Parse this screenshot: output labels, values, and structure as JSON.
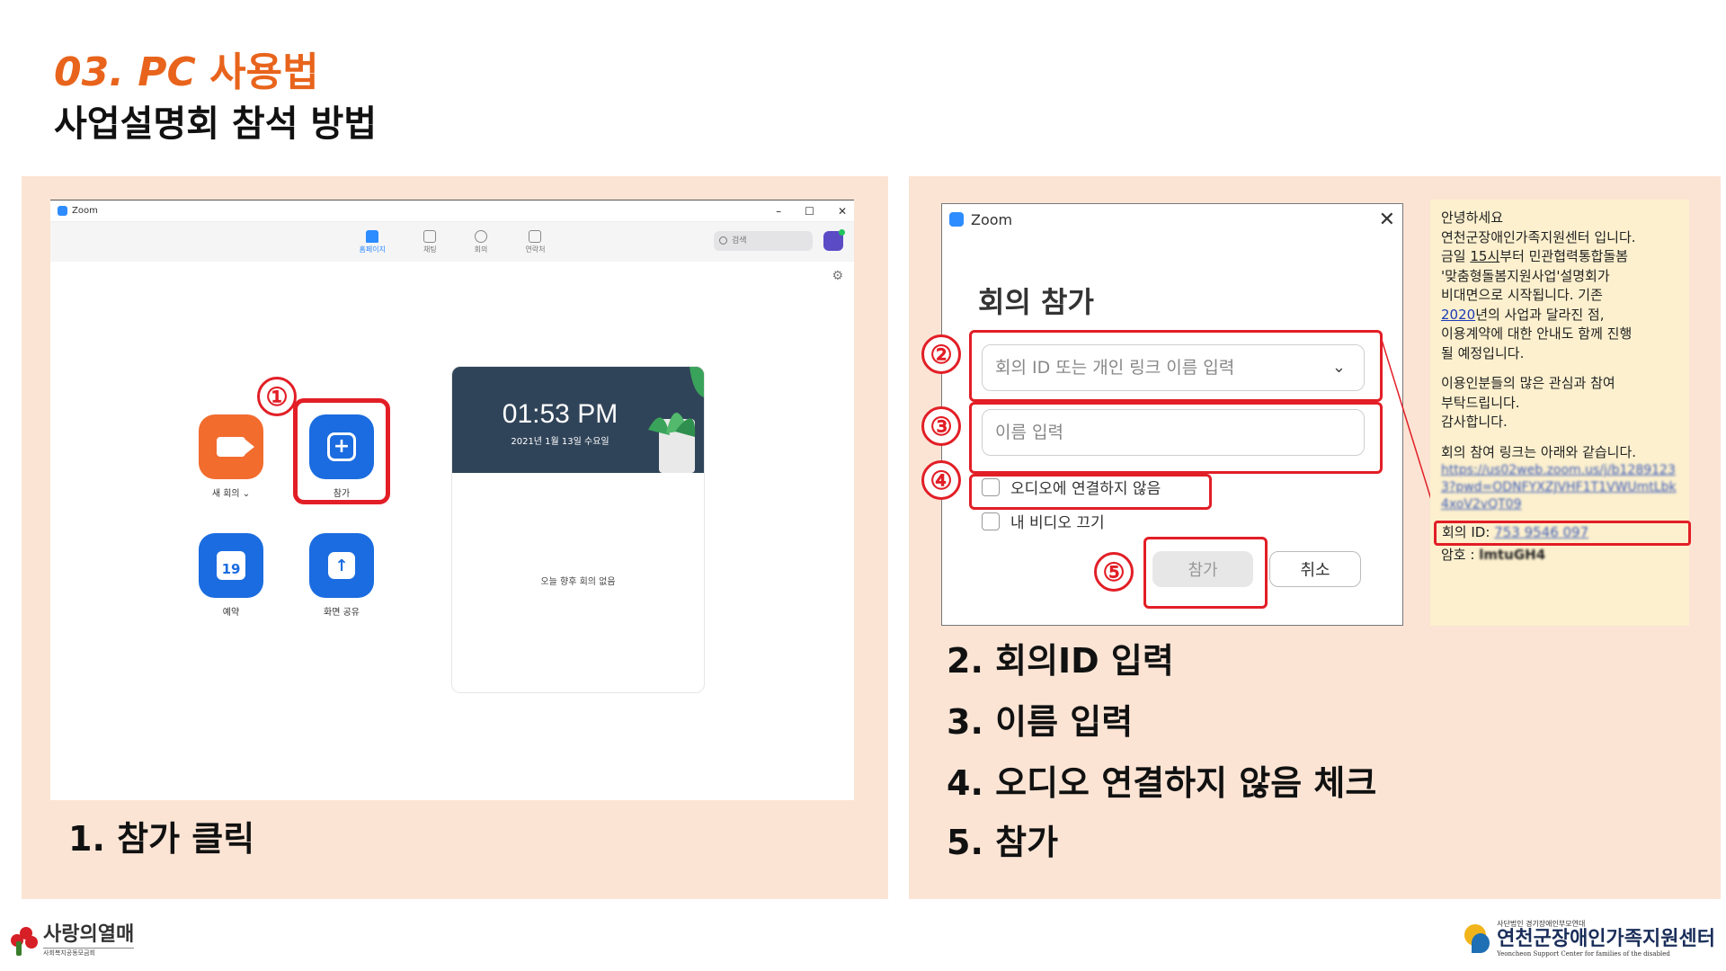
{
  "header": {
    "section_num": "03. PC",
    "section_title": "사용법",
    "subtitle": "사업설명회 참석 방법"
  },
  "left_panel": {
    "zoom_window": {
      "title": "Zoom",
      "controls": [
        "–",
        "☐",
        "✕"
      ],
      "nav": [
        {
          "label": "홈페이지",
          "icon": "home-icon",
          "active": true
        },
        {
          "label": "채팅",
          "icon": "chat-icon",
          "active": false
        },
        {
          "label": "회의",
          "icon": "clock-icon",
          "active": false
        },
        {
          "label": "연락처",
          "icon": "contacts-icon",
          "active": false
        }
      ],
      "search_placeholder": "검색",
      "tiles": {
        "new_meeting": "새 회의",
        "new_meeting_chevron": "⌄",
        "join": "참가",
        "schedule": "예약",
        "schedule_day": "19",
        "share_screen": "화면 공유"
      },
      "calendar": {
        "time": "01:53 PM",
        "date": "2021년 1월 13일 수요일",
        "empty_text": "오늘 향후 회의 없음"
      }
    },
    "badge_1": "①",
    "step_text": "1. 참가 클릭"
  },
  "right_panel": {
    "join_dialog": {
      "title": "Zoom",
      "heading": "회의 참가",
      "meeting_id_placeholder": "회의 ID 또는 개인 링크 이름 입력",
      "name_placeholder": "이름 입력",
      "checkbox_audio": "오디오에 연결하지 않음",
      "checkbox_video": "내 비디오 끄기",
      "join_button": "참가",
      "cancel_button": "취소"
    },
    "badges": [
      "②",
      "③",
      "④",
      "⑤"
    ],
    "sms": {
      "greeting": "안녕하세요",
      "line1": "연천군장애인가족지원센터 입니다.",
      "line2a": "금일 ",
      "line2b": "15시",
      "line2c": "부터 민관협력통합돌봄",
      "line3": "'맞춤형돌봄지원사업'설명회가",
      "line4": "비대면으로 시작됩니다. 기존",
      "line5a": "2020",
      "line5b": "년의 사업과 달라진 점,",
      "line6": "이용계약에 대한 안내도 함께 진행",
      "line7": "될 예정입니다.",
      "line8": "이용인분들의 많은 관심과 참여",
      "line9": "부탁드립니다.",
      "line10": "감사합니다.",
      "line11": "회의 참여 링크는 아래와 같습니다.",
      "link": "https://us02web.zoom.us/j/b12891233?pwd=ODNFYXZJVHF1T1VWUmtLbk4xoV2vQT09",
      "meeting_id_label": "회의 ID: ",
      "meeting_id_value": "753 9546 097",
      "password_label": "암호 : ",
      "password_value": "lmtuGH4"
    },
    "steps": [
      "2. 회의ID 입력",
      "3. 이름 입력",
      "4. 오디오 연결하지 않음 체크",
      "5. 참가"
    ]
  },
  "footer": {
    "left_logo_name": "사랑의열매",
    "left_logo_sub": "사회복지공동모금회",
    "right_logo_org": "사단법인 경기장애인부모연대",
    "right_logo_name": "연천군장애인가족지원센터",
    "right_logo_eng": "Yeoncheon Support Center for families of the disabled"
  },
  "colors": {
    "accent_orange": "#e8641c",
    "panel_bg": "#fbe4d4",
    "highlight_red": "#e21e26",
    "zoom_blue": "#1b6ce0",
    "zoom_orange": "#f26c2e"
  }
}
